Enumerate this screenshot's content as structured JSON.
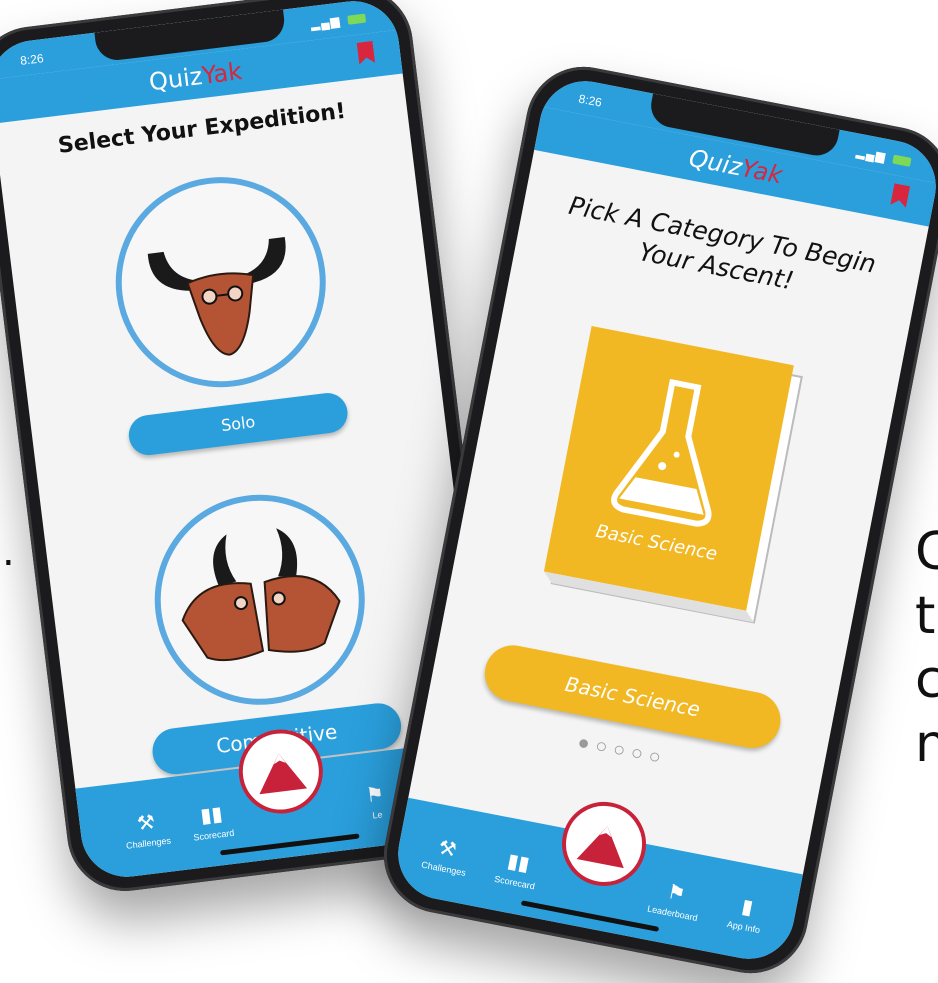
{
  "left_phone": {
    "status_time": "8:26",
    "app_logo": {
      "part1": "Quiz",
      "part2": "Yak"
    },
    "heading": "Select Your Expedition!",
    "buttons": {
      "solo": "Solo",
      "competitive": "Competitive"
    },
    "tabs": [
      {
        "icon": "⚒",
        "label": "Challenges"
      },
      {
        "icon": "▮▮",
        "label": "Scorecard"
      },
      {
        "icon": "⚑",
        "label": "Le"
      }
    ]
  },
  "right_phone": {
    "status_time": "8:26",
    "app_logo": {
      "part1": "Quiz",
      "part2": "Yak"
    },
    "heading_line1": "Pick A Category To Begin",
    "heading_line2": "Your Ascent!",
    "book_label": "Basic Science",
    "category_button": "Basic Science",
    "page_dots": "●○○○○",
    "tabs": [
      {
        "icon": "⚒",
        "label": "Challenges"
      },
      {
        "icon": "▮▮",
        "label": "Scorecard"
      },
      {
        "icon": "⚑",
        "label": "Leaderboard"
      },
      {
        "icon": "▮",
        "label": "App Info"
      }
    ]
  },
  "side_text": [
    "C",
    "t",
    "c",
    "n"
  ],
  "stray_mark": ".",
  "colors": {
    "primary": "#2a9fdc",
    "accent_red": "#d7263d",
    "yellow": "#f2b824",
    "yak_brown": "#b45434"
  }
}
